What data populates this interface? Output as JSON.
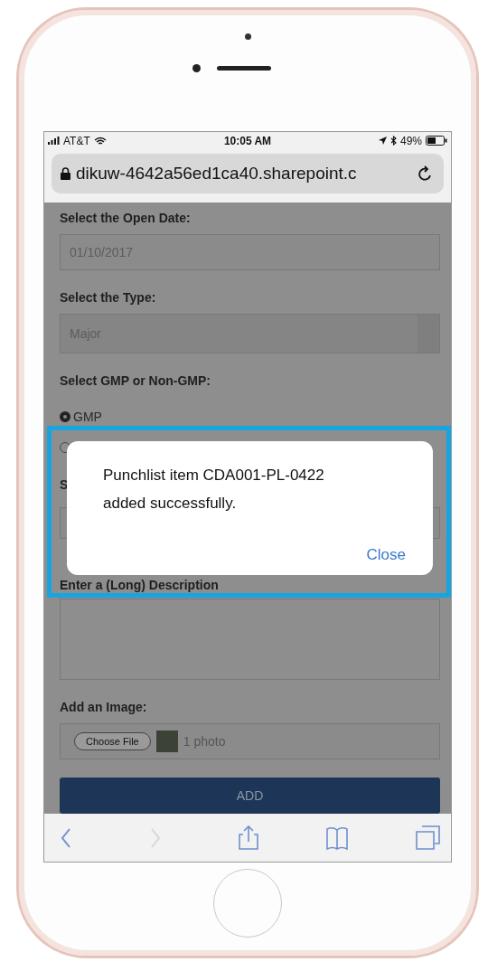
{
  "status_bar": {
    "carrier": "AT&T",
    "time": "10:05 AM",
    "battery": "49%"
  },
  "address_bar": {
    "url": "dikuw-4642a56ed1ca40.sharepoint.c"
  },
  "form": [
    {
      "kind": "text",
      "label": "Select the Open Date:",
      "value": "01/10/2017"
    },
    {
      "kind": "select",
      "label": "Select the Type:",
      "value": "Major"
    },
    {
      "kind": "radio",
      "label": "Select GMP or Non-GMP:",
      "options": [
        {
          "label": "GMP",
          "selected": true
        },
        {
          "selected": false
        }
      ]
    },
    {
      "kind": "text",
      "label": "S"
    },
    {
      "kind": "textarea",
      "label": "Enter a (Long) Description"
    },
    {
      "kind": "file",
      "label": "Add an Image:",
      "button": "Choose File",
      "value": "1 photo"
    }
  ],
  "submit": "ADD",
  "dialog": {
    "message": "Punchlist item CDA001-PL-0422 added successfully.",
    "button": "Close"
  },
  "toolbar": [
    {
      "kind": "back",
      "disabled": false
    },
    {
      "kind": "forward",
      "disabled": true
    },
    {
      "kind": "share",
      "disabled": false
    },
    {
      "kind": "bookmarks",
      "disabled": false
    },
    {
      "kind": "tabs",
      "disabled": false
    }
  ]
}
